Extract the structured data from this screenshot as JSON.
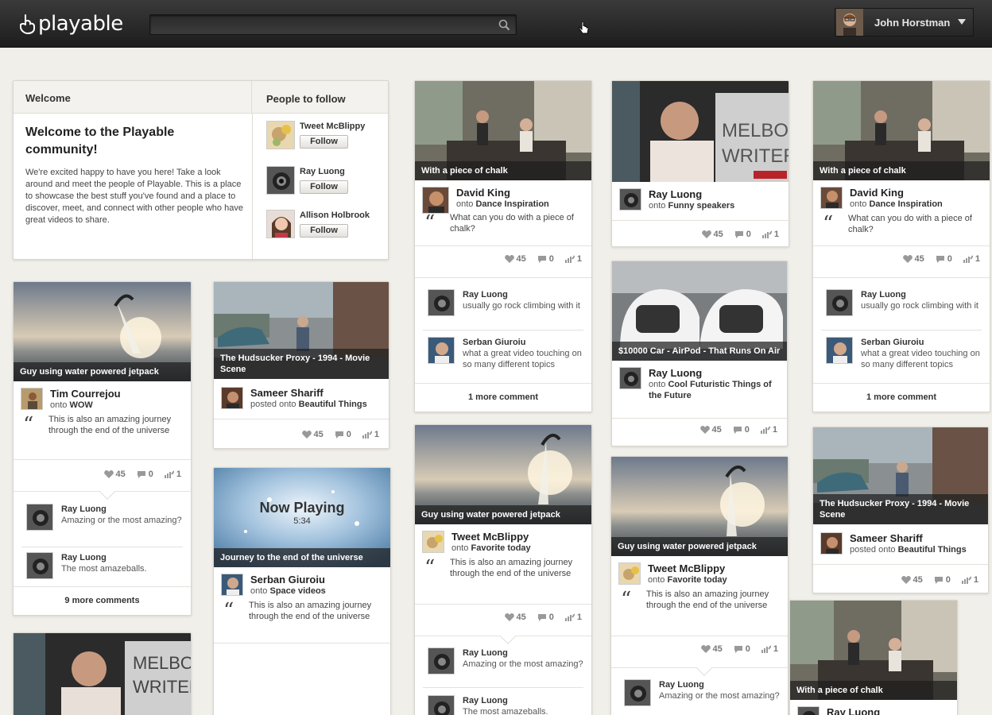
{
  "header": {
    "logo": "playable",
    "search_placeholder": "",
    "user_name": "John Horstman"
  },
  "welcome": {
    "tab_label": "Welcome",
    "title": "Welcome to the Playable community!",
    "body": "We're excited happy to have you here! Take a look around and meet the people of Playable. This is a place to showcase the best stuff you've found and a place to discover, meet, and connect with other people who have great videos to share.",
    "people_label": "People to follow",
    "follow_label": "Follow",
    "people": [
      "Tweet McBlippy",
      "Ray Luong",
      "Allison Holbrook"
    ]
  },
  "cards": {
    "jetpack1": {
      "caption": "Guy using water powered jetpack",
      "author": "Tim Courrejou",
      "onto_prefix": "onto",
      "board": "WOW",
      "quote": "This is also an amazing journey through the end of the universe",
      "likes": "45",
      "comments": "0",
      "shares": "1",
      "c1_name": "Ray Luong",
      "c1_text": "Amazing or the most amazing?",
      "c2_name": "Ray Luong",
      "c2_text": "The most amazeballs.",
      "more": "9 more comments"
    },
    "hudsucker1": {
      "caption": "The Hudsucker Proxy - 1994 - Movie Scene",
      "author": "Sameer Shariff",
      "onto_prefix": "posted onto",
      "board": "Beautiful Things",
      "likes": "45",
      "comments": "0",
      "shares": "1"
    },
    "nowplaying": {
      "now_playing": "Now Playing",
      "duration": "5:34",
      "caption": "Journey to the end of the universe",
      "author": "Serban Giuroiu",
      "onto_prefix": "onto",
      "board": "Space videos",
      "quote": "This is also an amazing journey through the end of the universe"
    },
    "chalk1": {
      "caption": "With a piece of chalk",
      "author": "David King",
      "onto_prefix": "onto",
      "board": "Dance Inspiration",
      "quote": "What can you do with a piece of chalk?",
      "likes": "45",
      "comments": "0",
      "shares": "1",
      "c1_name": "Ray Luong",
      "c1_text": "usually go rock climbing with it",
      "c2_name": "Serban Giuroiu",
      "c2_text": "what a great video touching on so many different topics",
      "more": "1 more comment"
    },
    "jetpack2": {
      "caption": "Guy using water powered jetpack",
      "author": "Tweet McBlippy",
      "onto_prefix": "onto",
      "board": "Favorite today",
      "quote": "This is also an amazing journey through the end of the universe",
      "likes": "45",
      "comments": "0",
      "shares": "1",
      "c1_name": "Ray Luong",
      "c1_text": "Amazing or the most amazing?",
      "c2_name": "Ray Luong",
      "c2_text": "The most amazeballs."
    },
    "speaker1": {
      "author": "Ray Luong",
      "onto_prefix": "onto",
      "board": "Funny speakers",
      "likes": "45",
      "comments": "0",
      "shares": "1"
    },
    "airpod": {
      "caption": "$10000 Car - AirPod - That Runs On Air",
      "author": "Ray Luong",
      "onto_prefix": "onto",
      "board": "Cool Futuristic Things of the Future",
      "likes": "45",
      "comments": "0",
      "shares": "1"
    },
    "jetpack3": {
      "caption": "Guy using water powered jetpack",
      "author": "Tweet McBlippy",
      "onto_prefix": "onto",
      "board": "Favorite today",
      "quote": "This is also an amazing journey through the end of the universe",
      "likes": "45",
      "comments": "0",
      "shares": "1",
      "c1_name": "Ray Luong",
      "c1_text": "Amazing or the most amazing?"
    },
    "chalk2": {
      "caption": "With a piece of chalk",
      "author": "David King",
      "onto_prefix": "onto",
      "board": "Dance Inspiration",
      "quote": "What can you do with a piece of chalk?",
      "likes": "45",
      "comments": "0",
      "shares": "1",
      "c1_name": "Ray Luong",
      "c1_text": "usually go rock climbing with it",
      "c2_name": "Serban Giuroiu",
      "c2_text": "what a great video touching on so many different topics",
      "more": "1 more comment"
    },
    "hudsucker2": {
      "caption": "The Hudsucker Proxy - 1994 - Movie Scene",
      "author": "Sameer Shariff",
      "onto_prefix": "posted onto",
      "board": "Beautiful Things",
      "likes": "45",
      "comments": "0",
      "shares": "1"
    },
    "chalk3": {
      "caption": "With a piece of chalk",
      "author": "Ray Luong"
    }
  },
  "colors": {
    "topbar": "#262626",
    "page_bg": "#f1efea",
    "caption_bg": "#1e1e1e"
  }
}
